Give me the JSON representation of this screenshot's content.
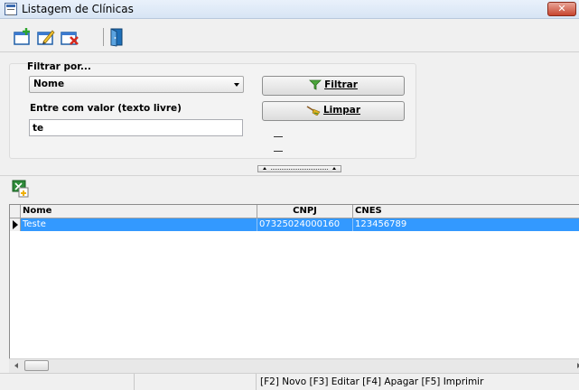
{
  "window": {
    "title": "Listagem de Clínicas",
    "close_label": "✕"
  },
  "toolbar": {
    "buttons": [
      {
        "icon": "new-document-icon"
      },
      {
        "icon": "edit-icon"
      },
      {
        "icon": "delete-icon"
      },
      {
        "icon": "exit-door-icon"
      }
    ]
  },
  "filter": {
    "group_label": "Filtrar por...",
    "field_selected": "Nome",
    "value_label": "Entre com valor (texto livre)",
    "value": "te",
    "filter_button": "Filtrar",
    "clear_button": "Limpar"
  },
  "grid": {
    "columns": [
      "Nome",
      "CNPJ",
      "CNES"
    ],
    "rows": [
      {
        "nome": "Teste",
        "cnpj": "07325024000160",
        "cnes": "123456789",
        "selected": true
      }
    ]
  },
  "status": {
    "shortcuts": "[F2] Novo [F3] Editar [F4] Apagar [F5] Imprimir"
  },
  "colors": {
    "selection": "#3399ff",
    "close": "#c7452f"
  }
}
